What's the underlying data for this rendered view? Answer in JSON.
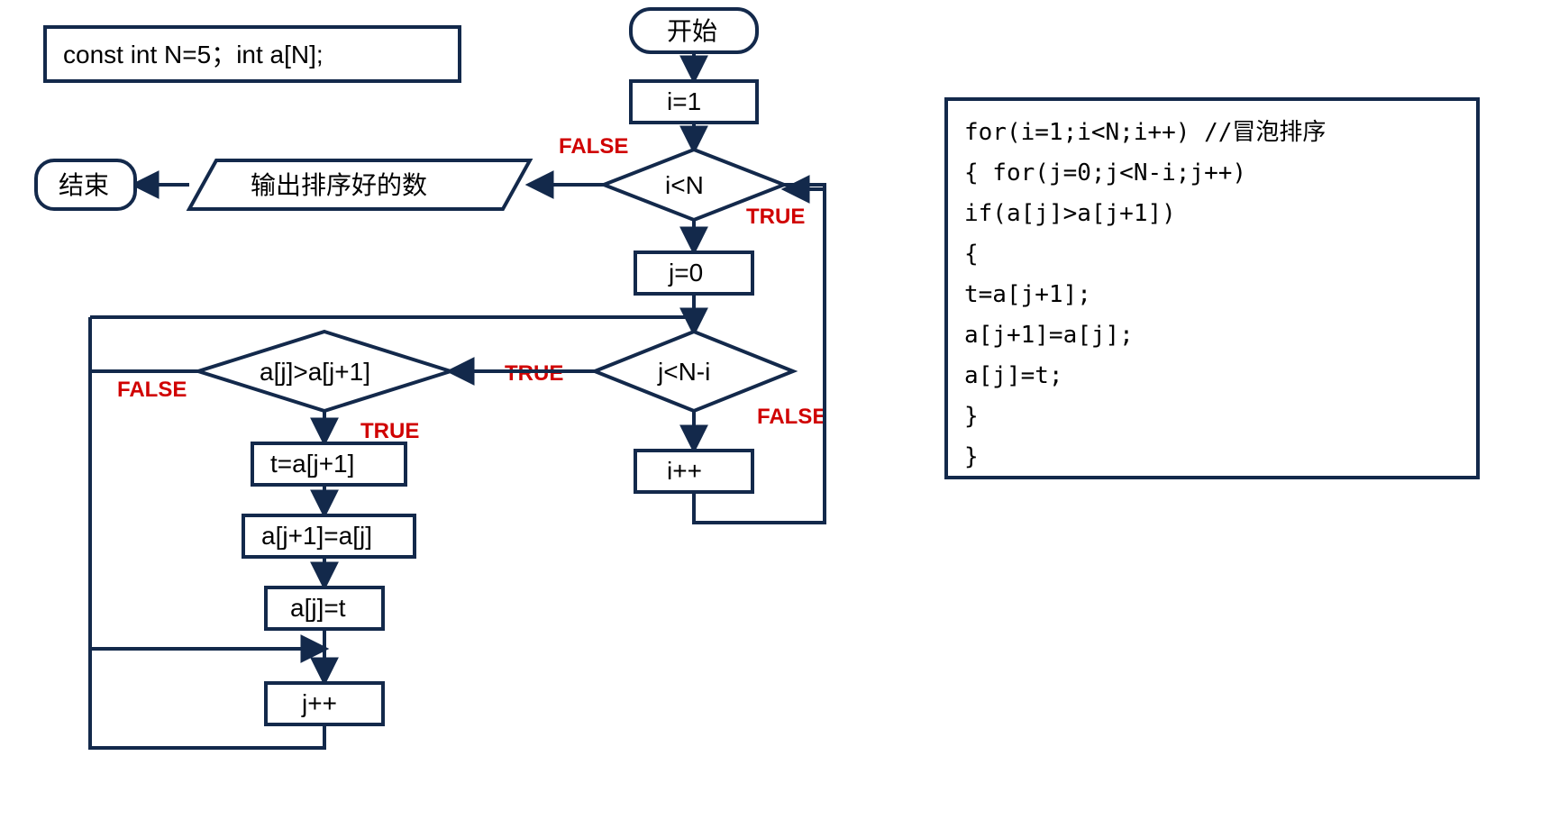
{
  "decl": "const int N=5；int a[N];",
  "start": "开始",
  "end": "结束",
  "output": "输出排序好的数",
  "i_init": "i=1",
  "i_test": "i<N",
  "j_init": "j=0",
  "j_test": "j<N-i",
  "cmp": "a[j]>a[j+1]",
  "s1": "t=a[j+1]",
  "s2": "a[j+1]=a[j]",
  "s3": "a[j]=t",
  "j_inc": "j++",
  "i_inc": "i++",
  "TRUE": "TRUE",
  "FALSE": "FALSE",
  "code": {
    "l1": "for(i=1;i<N;i++)  //冒泡排序",
    "l2": "   { for(j=0;j<N-i;j++)",
    "l3": "       if(a[j]>a[j+1])",
    "l4": "         {",
    "l5": "            t=a[j+1];",
    "l6": "            a[j+1]=a[j];",
    "l7": "            a[j]=t;",
    "l8": "          }",
    "l9": "    }"
  }
}
